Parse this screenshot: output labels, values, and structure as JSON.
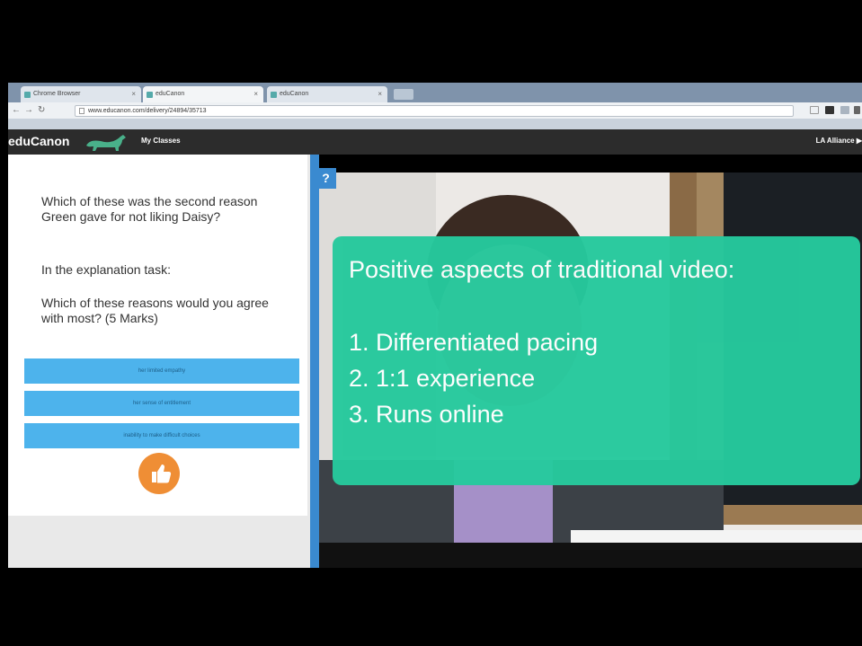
{
  "browser": {
    "tabs": [
      {
        "title": "Chrome Browser"
      },
      {
        "title": "eduCanon"
      },
      {
        "title": "eduCanon"
      }
    ],
    "url": "www.educanon.com/delivery/24894/35713"
  },
  "app": {
    "logo": "eduCanon",
    "nav_my_classes": "My Classes",
    "account": "LA Alliance ▶"
  },
  "question": {
    "prompt_1": "Which of these was the second reason Green gave for not liking Daisy?",
    "prompt_2": "In the explanation task:",
    "prompt_3": "Which of these reasons would you agree with most? (5 Marks)",
    "badge": "?",
    "answers": [
      {
        "label": "her limited empathy"
      },
      {
        "label": "her sense of entitlement"
      },
      {
        "label": "inability to make difficult choices"
      }
    ],
    "submit_icon": "thumbs-up-icon"
  },
  "overlay": {
    "title": "Positive aspects of traditional video:",
    "items": [
      "1. Differentiated pacing",
      "2. 1:1 experience",
      "3. Runs online"
    ]
  },
  "colors": {
    "overlay": "#26c99d",
    "answer_button": "#4db3ec",
    "accent_blue": "#3a8ad0",
    "submit": "#ef8e35",
    "appbar": "#2c2c2c"
  }
}
